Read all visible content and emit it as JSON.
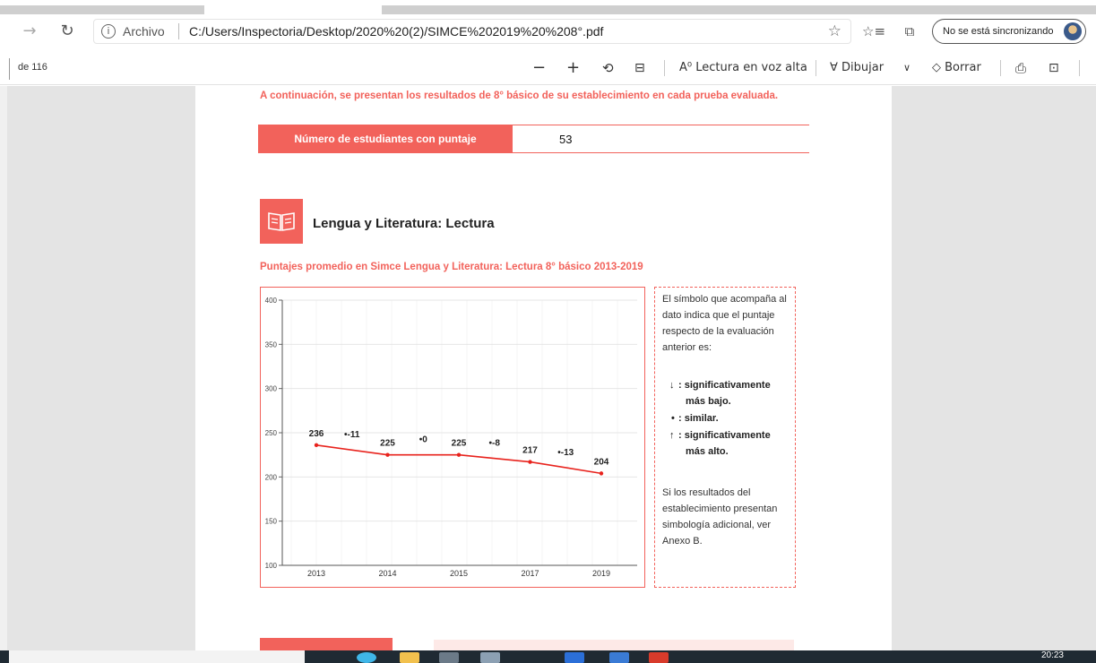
{
  "browser": {
    "nav_forward_icon": "arrow-right-icon",
    "nav_refresh_icon": "refresh-icon",
    "url_scheme_label": "Archivo",
    "url": "C:/Users/Inspectoria/Desktop/2020%20(2)/SIMCE%202019%20%208°.pdf",
    "sync_label": "No se está sincronizando"
  },
  "pdf_toolbar": {
    "page_count": "de 116",
    "read_aloud": "Lectura en voz alta",
    "draw": "Dibujar",
    "erase": "Borrar"
  },
  "document": {
    "intro_text": "A continuación, se presentan los resultados de 8° básico de su establecimiento en cada prueba evaluada.",
    "count_label": "Número de estudiantes con puntaje",
    "count_value": "53",
    "section_title": "Lengua y Literatura: Lectura",
    "chart_subtitle": "Puntajes promedio en Simce Lengua y Literatura: Lectura 8° básico 2013-2019",
    "legend": {
      "intro": "El símbolo que acompaña al dato indica que el puntaje respecto de la evaluación anterior es:",
      "down_symbol": "↓",
      "down_text_1": ": significativamente",
      "down_text_2": "más bajo.",
      "similar_symbol": "•",
      "similar_text": ": similar.",
      "up_symbol": "↑",
      "up_text_1": ": significativamente",
      "up_text_2": "más alto.",
      "note": "Si los resultados del establecimiento presentan simbología adicional, ver Anexo B."
    }
  },
  "taskbar": {
    "clock": "20:23"
  },
  "colors": {
    "accent": "#f2625b",
    "line": "#e8231d"
  },
  "chart_data": {
    "type": "line",
    "title": "",
    "xlabel": "",
    "ylabel": "",
    "ylim": [
      100,
      400
    ],
    "yticks": [
      100,
      150,
      200,
      250,
      300,
      350,
      400
    ],
    "categories": [
      "2013",
      "2014",
      "2015",
      "2017",
      "2019"
    ],
    "values": [
      236,
      225,
      225,
      217,
      204
    ],
    "value_labels": [
      "236",
      "225",
      "225",
      "217",
      "204"
    ],
    "change_labels": [
      "•-11",
      "•0",
      "•-8",
      "•-13"
    ],
    "grid": true
  }
}
